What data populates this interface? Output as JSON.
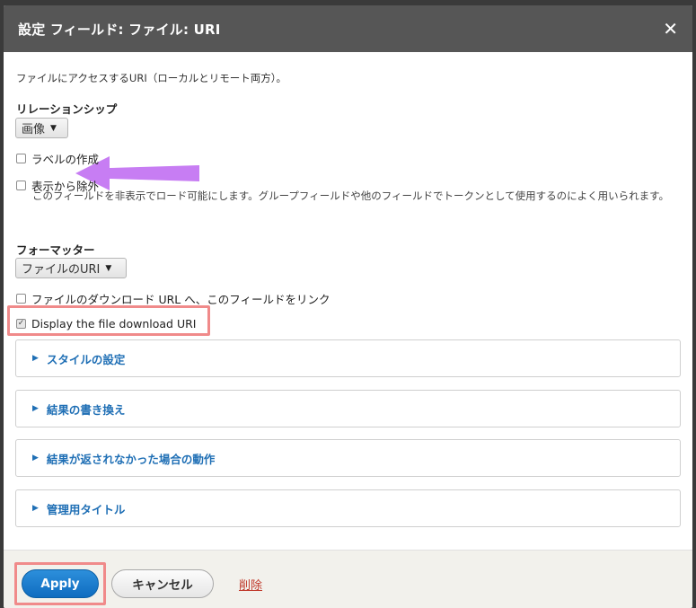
{
  "dialog": {
    "title": "設定 フィールド: ファイル: URI",
    "close_glyph": "✕"
  },
  "form": {
    "description": "ファイルにアクセスするURI（ローカルとリモート両方）。",
    "relationship": {
      "label": "リレーションシップ",
      "selected": "画像"
    },
    "create_label": {
      "label": "ラベルの作成",
      "checked": false
    },
    "exclude": {
      "label": "表示から除外",
      "checked": false,
      "help": "このフィールドを非表示でロード可能にします。グループフィールドや他のフィールドでトークンとして使用するのによく用いられます。"
    },
    "formatter": {
      "label": "フォーマッター",
      "selected": "ファイルのURI"
    },
    "link_to_file": {
      "label": "ファイルのダウンロード URL へ、このフィールドをリンク",
      "checked": false
    },
    "display_uri": {
      "label": "Display the file download URI",
      "checked": true
    }
  },
  "sections": [
    {
      "label": "スタイルの設定"
    },
    {
      "label": "結果の書き換え"
    },
    {
      "label": "結果が返されなかった場合の動作"
    },
    {
      "label": "管理用タイトル"
    }
  ],
  "footer": {
    "apply_label": "Apply",
    "cancel_label": "キャンセル",
    "delete_label": "削除"
  },
  "colors": {
    "annotation_highlight": "#f08a8a",
    "annotation_arrow": "#c77df3",
    "primary_button": "#1a7bcf",
    "link": "#1f6fb5"
  }
}
